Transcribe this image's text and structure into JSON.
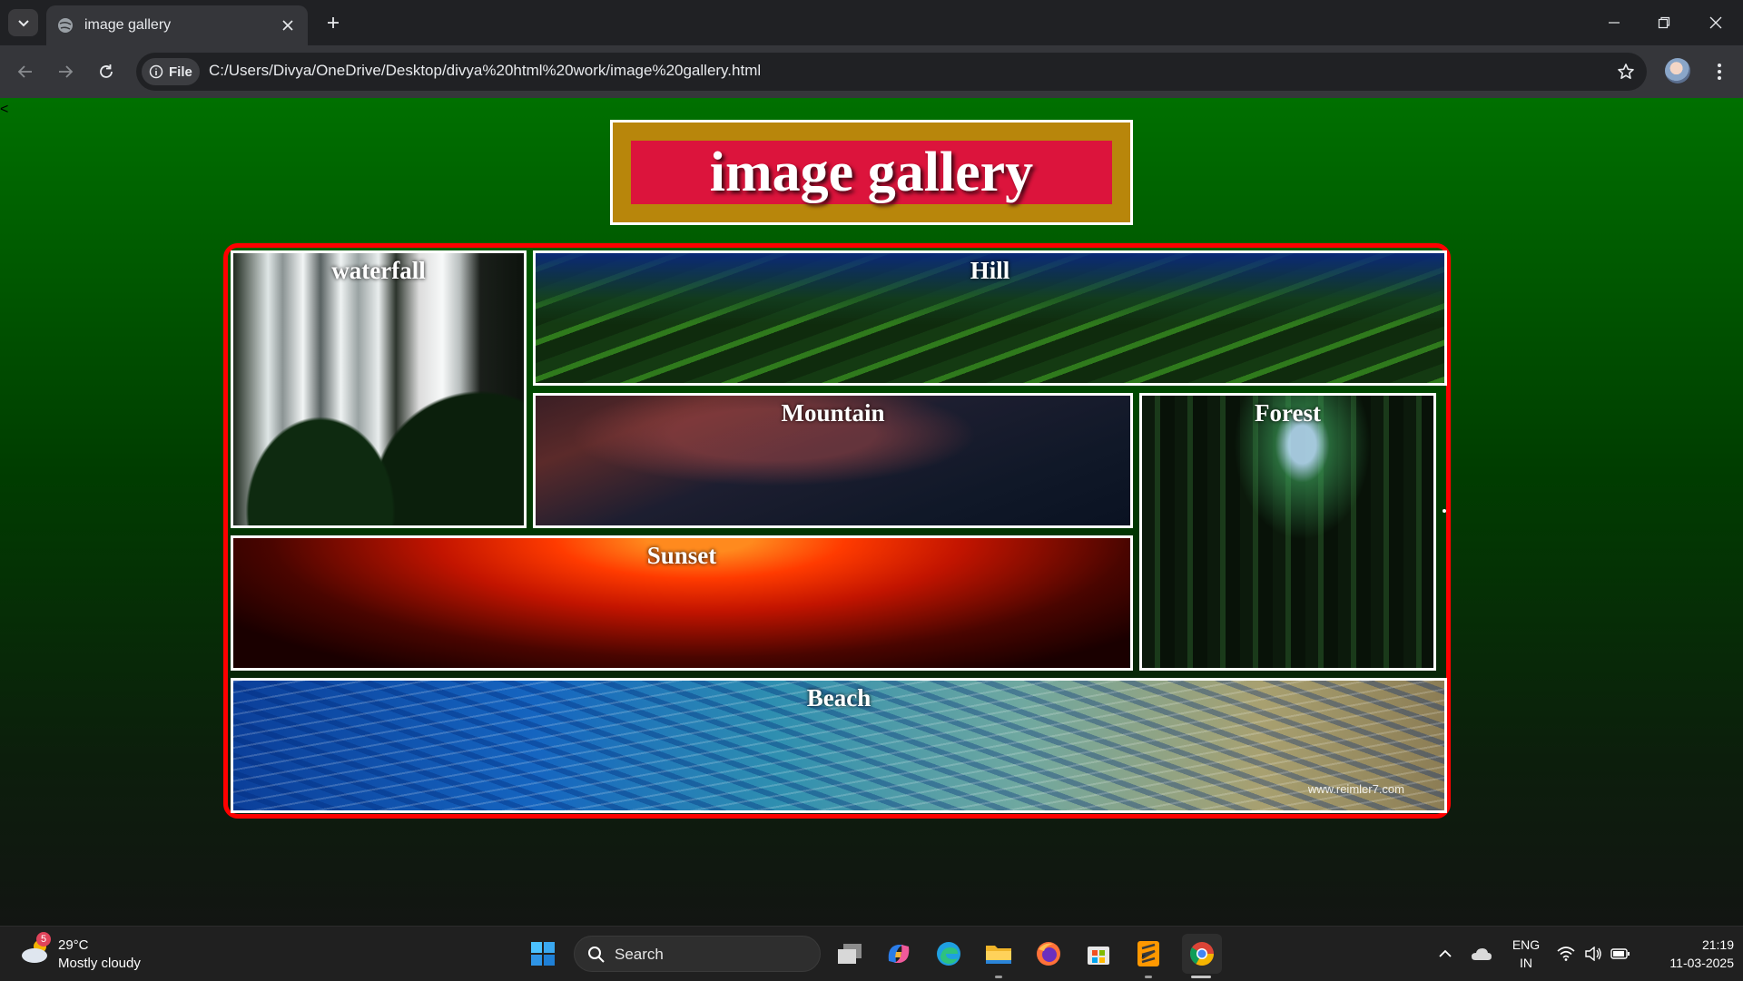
{
  "browser": {
    "tab_title": "image gallery",
    "url_chip": "File",
    "url": "C:/Users/Divya/OneDrive/Desktop/divya%20html%20work/image%20gallery.html"
  },
  "page": {
    "corner_mark": "<",
    "heading": "image gallery",
    "gallery": [
      {
        "label": "waterfall"
      },
      {
        "label": "Hill"
      },
      {
        "label": "Mountain"
      },
      {
        "label": "Forest"
      },
      {
        "label": "Sunset"
      },
      {
        "label": "Beach",
        "watermark": "www.reimler7.com"
      }
    ]
  },
  "taskbar": {
    "weather_badge": "5",
    "temperature": "29°C",
    "condition": "Mostly cloudy",
    "search_placeholder": "Search",
    "language": "ENG",
    "region": "IN",
    "time": "21:19",
    "date": "11-03-2025"
  },
  "colors": {
    "page_gradient_top": "#007000",
    "title_frame": "#b8860b",
    "title_bar": "#dc143c",
    "gallery_border": "#ff0000"
  },
  "icons": [
    "tab-search-icon",
    "globe-icon",
    "close-icon",
    "plus-icon",
    "minimize-icon",
    "restore-icon",
    "back-icon",
    "forward-icon",
    "reload-icon",
    "info-icon",
    "star-icon",
    "kebab-menu-icon",
    "windows-start-icon",
    "search-icon",
    "task-view-icon",
    "copilot-icon",
    "edge-icon",
    "file-explorer-icon",
    "firefox-icon",
    "store-icon",
    "sublime-icon",
    "chrome-icon",
    "chevron-up-icon",
    "onedrive-icon",
    "wifi-icon",
    "volume-icon",
    "battery-icon"
  ]
}
